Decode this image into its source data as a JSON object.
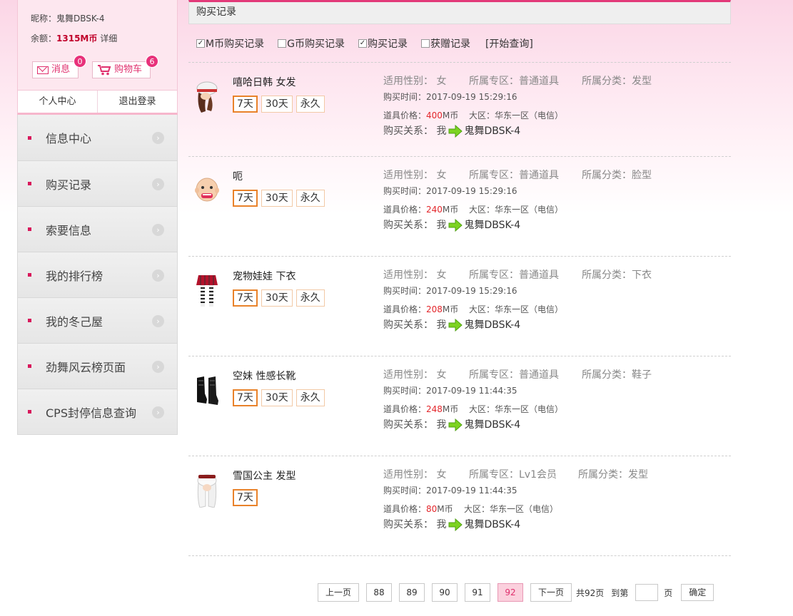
{
  "profile": {
    "nickname_label": "昵称：",
    "nickname": "鬼舞DBSK-4",
    "balance_label": "余额：",
    "balance": "1315M币",
    "detail_link": "详细",
    "messages_label": "消息",
    "messages_count": "0",
    "cart_label": "购物车",
    "cart_count": "6"
  },
  "account_tabs": [
    "个人中心",
    "退出登录"
  ],
  "menu": [
    "信息中心",
    "购买记录",
    "索要信息",
    "我的排行榜",
    "我的冬己屋",
    "劲舞风云榜页面",
    "CPS封停信息查询"
  ],
  "header": {
    "title": "购买记录"
  },
  "filters": [
    {
      "label": "M币购买记录",
      "checked": true
    },
    {
      "label": "G币购买记录",
      "checked": false
    },
    {
      "label": "购买记录",
      "checked": true
    },
    {
      "label": "获赠记录",
      "checked": false
    }
  ],
  "query_button": "[开始查询]",
  "labels": {
    "gender": "适用性别：",
    "zone": "所属专区：",
    "category": "所属分类：",
    "time": "购买时间：",
    "price": "道具价格：",
    "currency": "M币",
    "region": "大区：",
    "relation": "购买关系：",
    "me": "我"
  },
  "records": [
    {
      "name": "嘻哈日韩 女发",
      "durations": [
        "7天",
        "30天",
        "永久"
      ],
      "gender": "女",
      "zone": "普通道具",
      "category": "发型",
      "time": "2017-09-19 15:29:16",
      "price": "400",
      "region": "华东一区（电信）",
      "target": "鬼舞DBSK-4",
      "thumb": "hair-hat-icon"
    },
    {
      "name": "呃",
      "durations": [
        "7天",
        "30天",
        "永久"
      ],
      "gender": "女",
      "zone": "普通道具",
      "category": "脸型",
      "time": "2017-09-19 15:29:16",
      "price": "240",
      "region": "华东一区（电信）",
      "target": "鬼舞DBSK-4",
      "thumb": "face-icon"
    },
    {
      "name": "宠物娃娃 下衣",
      "durations": [
        "7天",
        "30天",
        "永久"
      ],
      "gender": "女",
      "zone": "普通道具",
      "category": "下衣",
      "time": "2017-09-19 15:29:16",
      "price": "208",
      "region": "华东一区（电信）",
      "target": "鬼舞DBSK-4",
      "thumb": "skirt-icon"
    },
    {
      "name": "空妹 性感长靴",
      "durations": [
        "7天",
        "30天",
        "永久"
      ],
      "gender": "女",
      "zone": "普通道具",
      "category": "鞋子",
      "time": "2017-09-19 11:44:35",
      "price": "248",
      "region": "华东一区（电信）",
      "target": "鬼舞DBSK-4",
      "thumb": "boots-icon"
    },
    {
      "name": "雪国公主 发型",
      "durations": [
        "7天"
      ],
      "gender": "女",
      "zone": "Lv1会员",
      "category": "发型",
      "time": "2017-09-19 11:44:35",
      "price": "80",
      "region": "华东一区（电信）",
      "target": "鬼舞DBSK-4",
      "thumb": "white-hair-icon"
    }
  ],
  "pager": {
    "prev": "上一页",
    "pages": [
      "88",
      "89",
      "90",
      "91",
      "92"
    ],
    "current": "92",
    "next": "下一页",
    "total": "共92页",
    "goto_label": "到第",
    "page_unit": "页",
    "confirm": "确定"
  },
  "colors": {
    "accent": "#e23a79",
    "price": "#e3262b",
    "duration_selected": "#e9822a"
  }
}
